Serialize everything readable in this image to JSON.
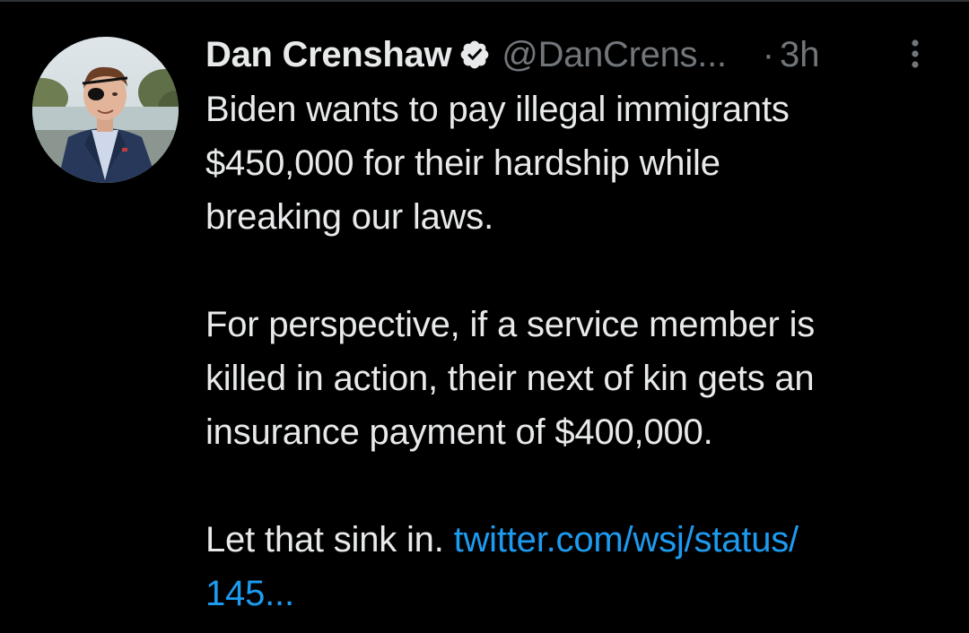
{
  "author": {
    "display_name": "Dan Crenshaw",
    "handle": "@DanCrens...",
    "verified": true,
    "avatar_icon": "profile-photo"
  },
  "meta": {
    "separator": "·",
    "time": "3h"
  },
  "tweet": {
    "line1": "Biden wants to pay illegal immigrants",
    "line2": "$450,000 for their hardship while",
    "line3": "breaking our laws.",
    "line4": "For perspective, if a service member is",
    "line5": "killed in action, their next of kin gets an",
    "line6": "insurance payment of $400,000.",
    "line7_text": "Let that sink in. ",
    "line7_link": "twitter.com/wsj/status/",
    "line8_link": "145..."
  },
  "colors": {
    "background": "#000000",
    "text": "#e7e9ea",
    "secondary": "#71767b",
    "link": "#1d9bf0"
  },
  "icons": {
    "verified": "verified-badge-icon",
    "more": "more-vertical-icon"
  }
}
